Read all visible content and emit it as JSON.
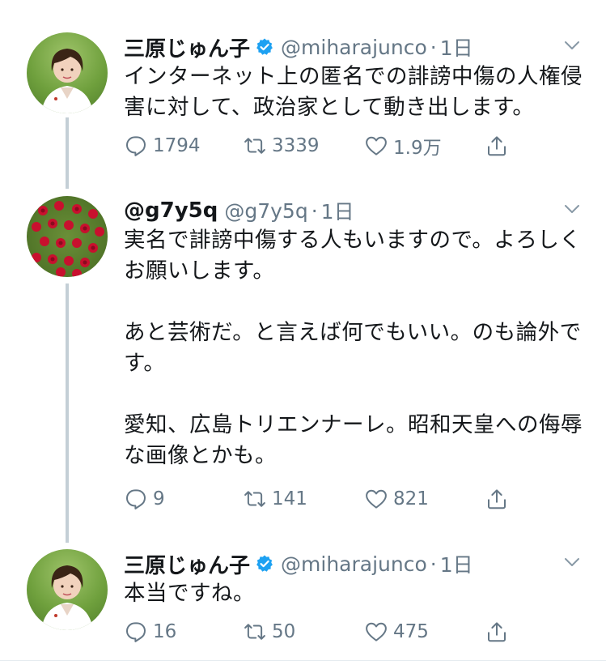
{
  "tweets": [
    {
      "display_name": "三原じゅん子",
      "verified": true,
      "handle": "@miharajunco",
      "separator": "·",
      "time": "1日",
      "avatar_icon": "person-avatar",
      "text": "インターネット上の匿名での誹謗中傷の人権侵害に対して、政治家として動き出します。",
      "replies": "1794",
      "retweets": "3339",
      "likes": "1.9万"
    },
    {
      "display_name": "@g7y5q",
      "verified": false,
      "handle": "@g7y5q",
      "separator": "·",
      "time": "1日",
      "avatar_icon": "roses-avatar",
      "text": "実名で誹謗中傷する人もいますので。よろしくお願いします。\n\nあと芸術だ。と言えば何でもいい。のも論外です。\n\n愛知、広島トリエンナーレ。昭和天皇への侮辱な画像とかも。",
      "replies": "9",
      "retweets": "141",
      "likes": "821"
    },
    {
      "display_name": "三原じゅん子",
      "verified": true,
      "handle": "@miharajunco",
      "separator": "·",
      "time": "1日",
      "avatar_icon": "person-avatar",
      "text": "本当ですね。",
      "replies": "16",
      "retweets": "50",
      "likes": "475"
    }
  ],
  "colors": {
    "text": "#14171a",
    "secondary": "#657786",
    "verified_blue": "#1da1f2",
    "thread_line": "#c4cfd6"
  }
}
